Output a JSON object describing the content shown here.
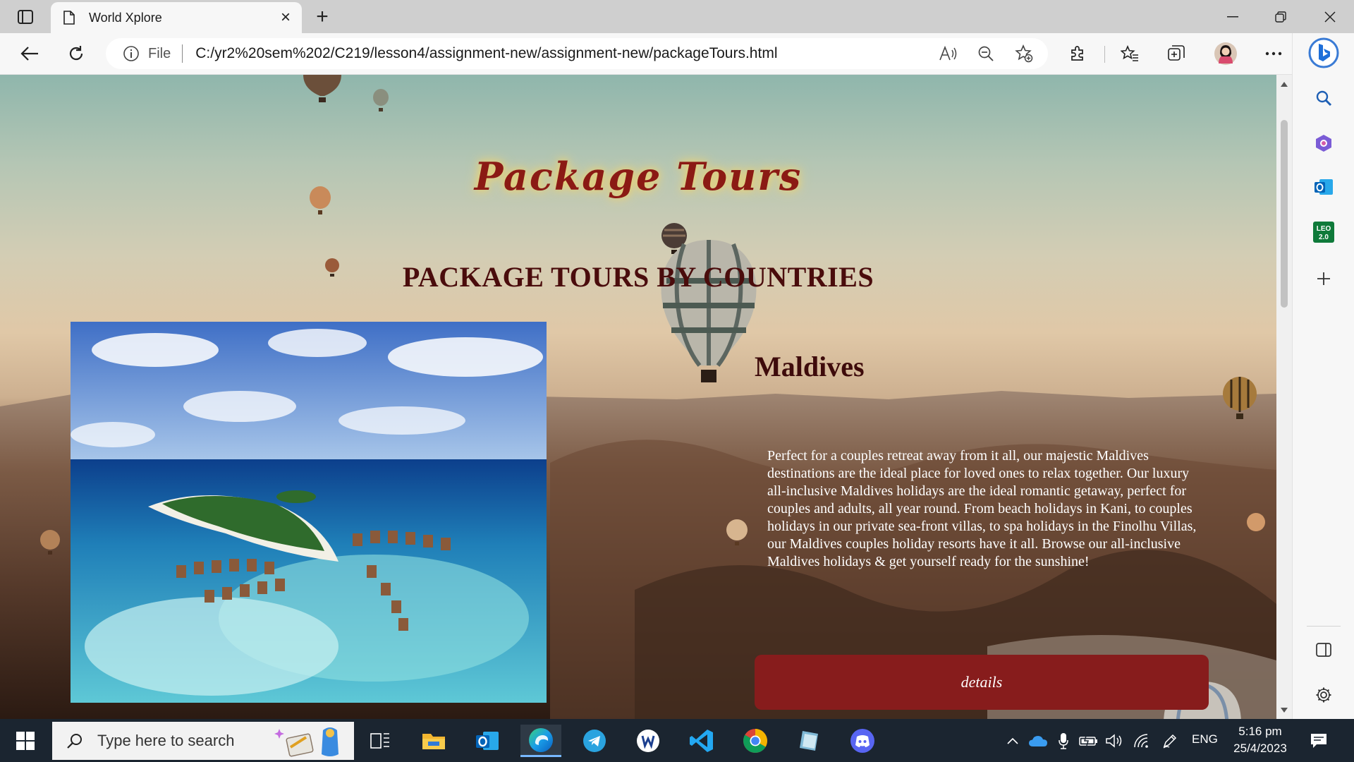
{
  "browser": {
    "tab_title": "World Xplore",
    "address_scheme": "File",
    "url": "C:/yr2%20sem%202/C219/lesson4/assignment-new/assignment-new/packageTours.html",
    "sidebar_badge": "LEO\n2.0"
  },
  "page": {
    "heading": "Package Tours",
    "section_heading": "PACKAGE TOURS BY COUNTRIES",
    "card": {
      "title": "Maldives",
      "description": "Perfect for a couples retreat away from it all, our majestic Maldives destinations are the ideal place for loved ones to relax together. Our luxury all-inclusive Maldives holidays are the ideal romantic getaway, perfect for couples and adults, all year round. From beach holidays in Kani, to couples holidays in our private sea-front villas, to spa holidays in the Finolhu Villas, our Maldives couples holiday resorts have it all. Browse our all-inclusive Maldives holidays & get yourself ready for the sunshine!",
      "button": "details"
    }
  },
  "taskbar": {
    "search_placeholder": "Type here to search",
    "language": "ENG",
    "time": "5:16 pm",
    "date": "25/4/2023"
  },
  "colors": {
    "heading": "#8b1a14",
    "button": "#871c1c",
    "section_heading": "#4a0c0c"
  }
}
